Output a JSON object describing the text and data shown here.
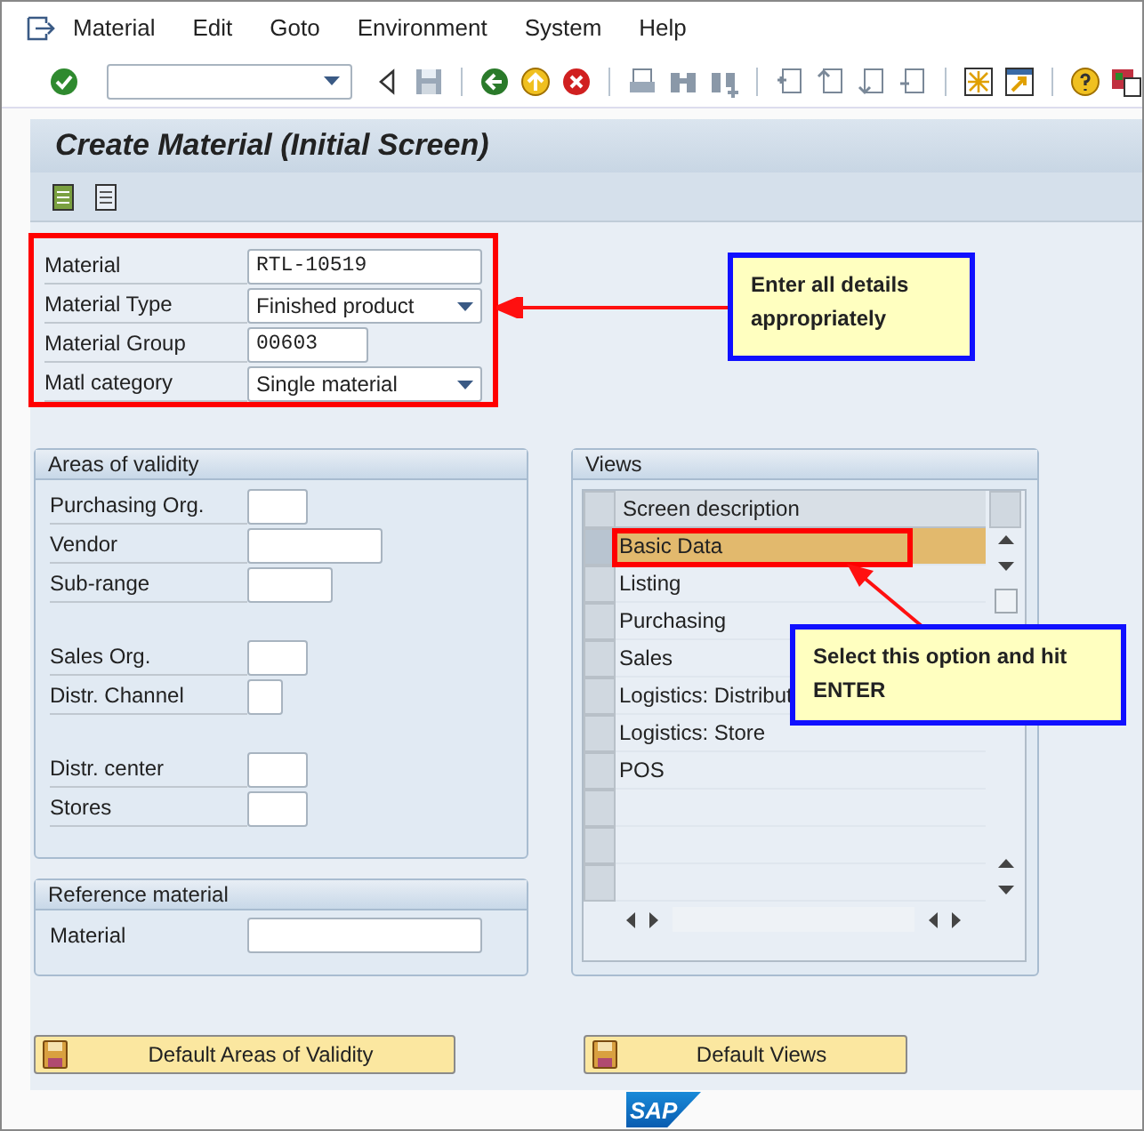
{
  "menu": [
    {
      "label": "Material"
    },
    {
      "label": "Edit"
    },
    {
      "label": "Goto"
    },
    {
      "label": "Environment"
    },
    {
      "label": "System"
    },
    {
      "label": "Help"
    }
  ],
  "title": "Create Material (Initial Screen)",
  "main_fields": [
    {
      "label": "Material",
      "value": "RTL-10519",
      "kind": "text"
    },
    {
      "label": "Material Type",
      "value": "Finished product",
      "kind": "dropdown"
    },
    {
      "label": "Material Group",
      "value": "00603",
      "kind": "text"
    },
    {
      "label": "Matl category",
      "value": "Single material",
      "kind": "dropdown"
    }
  ],
  "areas_of_validity": {
    "title": "Areas of validity",
    "groups": [
      [
        {
          "label": "Purchasing Org."
        },
        {
          "label": "Vendor"
        },
        {
          "label": "Sub-range"
        }
      ],
      [
        {
          "label": "Sales Org."
        },
        {
          "label": "Distr. Channel"
        }
      ],
      [
        {
          "label": "Distr. center"
        },
        {
          "label": "Stores"
        }
      ]
    ]
  },
  "reference_material": {
    "title": "Reference material",
    "fields": [
      {
        "label": "Material"
      }
    ]
  },
  "views": {
    "title": "Views",
    "column": "Screen description",
    "rows": [
      {
        "label": "Basic Data",
        "selected": true
      },
      {
        "label": "Listing",
        "selected": false
      },
      {
        "label": "Purchasing",
        "selected": false
      },
      {
        "label": "Sales",
        "selected": false
      },
      {
        "label": "Logistics: Distribut",
        "selected": false
      },
      {
        "label": "Logistics: Store",
        "selected": false
      },
      {
        "label": "POS",
        "selected": false
      }
    ]
  },
  "buttons": [
    "Default Areas of Validity",
    "Default Views"
  ],
  "logo": "SAP",
  "callouts": [
    "Enter all details appropriately",
    "Select this option and hit ENTER"
  ]
}
